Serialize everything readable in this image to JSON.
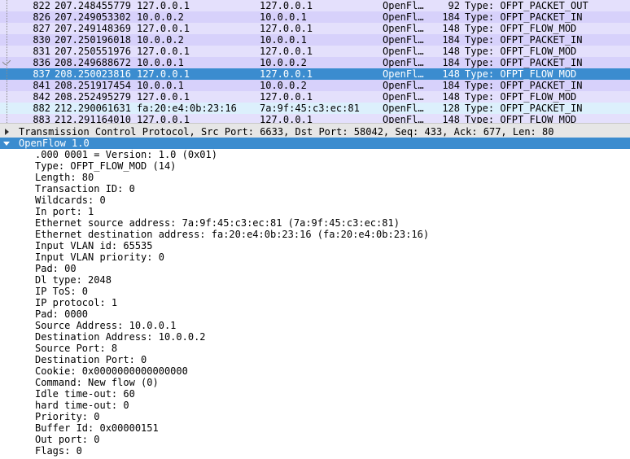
{
  "packets": [
    {
      "no": "822",
      "time": "207.248455779",
      "src": "127.0.0.1",
      "dst": "127.0.0.1",
      "proto": "OpenFl…",
      "len": "92",
      "info": "Type: OFPT_PACKET_OUT",
      "style": "of-a"
    },
    {
      "no": "826",
      "time": "207.249053302",
      "src": "10.0.0.2",
      "dst": "10.0.0.1",
      "proto": "OpenFl…",
      "len": "184",
      "info": "Type: OFPT_PACKET_IN",
      "style": "of-b"
    },
    {
      "no": "827",
      "time": "207.249148369",
      "src": "127.0.0.1",
      "dst": "127.0.0.1",
      "proto": "OpenFl…",
      "len": "148",
      "info": "Type: OFPT_FLOW_MOD",
      "style": "of-a"
    },
    {
      "no": "830",
      "time": "207.250196018",
      "src": "10.0.0.2",
      "dst": "10.0.0.1",
      "proto": "OpenFl…",
      "len": "184",
      "info": "Type: OFPT_PACKET_IN",
      "style": "of-b"
    },
    {
      "no": "831",
      "time": "207.250551976",
      "src": "127.0.0.1",
      "dst": "127.0.0.1",
      "proto": "OpenFl…",
      "len": "148",
      "info": "Type: OFPT_FLOW_MOD",
      "style": "of-a"
    },
    {
      "no": "836",
      "time": "208.249688672",
      "src": "10.0.0.1",
      "dst": "10.0.0.2",
      "proto": "OpenFl…",
      "len": "184",
      "info": "Type: OFPT_PACKET_IN",
      "style": "of-b"
    },
    {
      "no": "837",
      "time": "208.250023816",
      "src": "127.0.0.1",
      "dst": "127.0.0.1",
      "proto": "OpenFl…",
      "len": "148",
      "info": "Type: OFPT_FLOW_MOD",
      "style": "sel"
    },
    {
      "no": "841",
      "time": "208.251917454",
      "src": "10.0.0.1",
      "dst": "10.0.0.2",
      "proto": "OpenFl…",
      "len": "184",
      "info": "Type: OFPT_PACKET_IN",
      "style": "of-b"
    },
    {
      "no": "842",
      "time": "208.252495279",
      "src": "127.0.0.1",
      "dst": "127.0.0.1",
      "proto": "OpenFl…",
      "len": "148",
      "info": "Type: OFPT_FLOW_MOD",
      "style": "of-a"
    },
    {
      "no": "882",
      "time": "212.290061631",
      "src": "fa:20:e4:0b:23:16",
      "dst": "7a:9f:45:c3:ec:81",
      "proto": "OpenFl…",
      "len": "128",
      "info": "Type: OFPT_PACKET_IN",
      "style": "of-c"
    },
    {
      "no": "883",
      "time": "212.291164010",
      "src": "127.0.0.1",
      "dst": "127.0.0.1",
      "proto": "OpenFl…",
      "len": "148",
      "info": "Type: OFPT_FLOW_MOD",
      "style": "of-a"
    }
  ],
  "details": {
    "tcp_summary": "Transmission Control Protocol, Src Port: 6633, Dst Port: 58042, Seq: 433, Ack: 677, Len: 80",
    "openflow_label": "OpenFlow 1.0",
    "fields": [
      ".000 0001 = Version: 1.0 (0x01)",
      "Type: OFPT_FLOW_MOD (14)",
      "Length: 80",
      "Transaction ID: 0",
      "Wildcards: 0",
      "In port: 1",
      "Ethernet source address: 7a:9f:45:c3:ec:81 (7a:9f:45:c3:ec:81)",
      "Ethernet destination address: fa:20:e4:0b:23:16 (fa:20:e4:0b:23:16)",
      "Input VLAN id: 65535",
      "Input VLAN priority: 0",
      "Pad: 00",
      "Dl type: 2048",
      "IP ToS: 0",
      "IP protocol: 1",
      "Pad: 0000",
      "Source Address: 10.0.0.1",
      "Destination Address: 10.0.0.2",
      "Source Port: 8",
      "Destination Port: 0",
      "Cookie: 0x0000000000000000",
      "Command: New flow (0)",
      "Idle time-out: 60",
      "hard time-out: 0",
      "Priority: 0",
      "Buffer Id: 0x00000151",
      "Out port: 0",
      "Flags: 0"
    ]
  },
  "icons": {
    "collapsed": "triangle-right-icon",
    "expanded": "triangle-down-icon",
    "related": "checkmark-icon"
  }
}
